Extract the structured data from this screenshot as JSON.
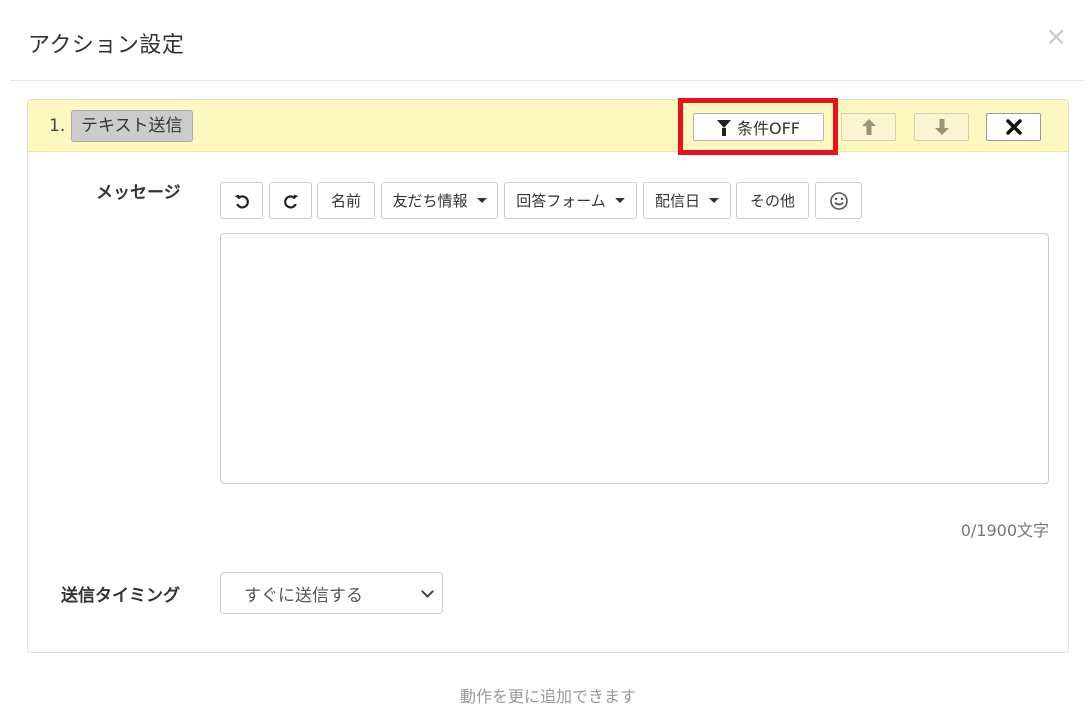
{
  "modal": {
    "title": "アクション設定",
    "close_label": "×"
  },
  "action": {
    "step_number": "1.",
    "type_label": "テキスト送信",
    "condition_button": "条件OFF",
    "move_up_icon": "arrow-up-icon",
    "move_down_icon": "arrow-down-icon",
    "delete_icon": "times-icon"
  },
  "message": {
    "label": "メッセージ",
    "toolbar": {
      "undo_icon": "undo-icon",
      "redo_icon": "redo-icon",
      "name": "名前",
      "friend_info": "友だち情報",
      "answer_form": "回答フォーム",
      "delivery_date": "配信日",
      "other": "その他",
      "emoji_icon": "smiley-icon"
    },
    "value": "",
    "counter": "0/1900文字"
  },
  "timing": {
    "label": "送信タイミング",
    "selected": "すぐに送信する"
  },
  "footer": {
    "add_more": "動作を更に追加できます"
  },
  "colors": {
    "panel_header_bg": "#fcf8c0",
    "highlight": "#e8121a"
  }
}
